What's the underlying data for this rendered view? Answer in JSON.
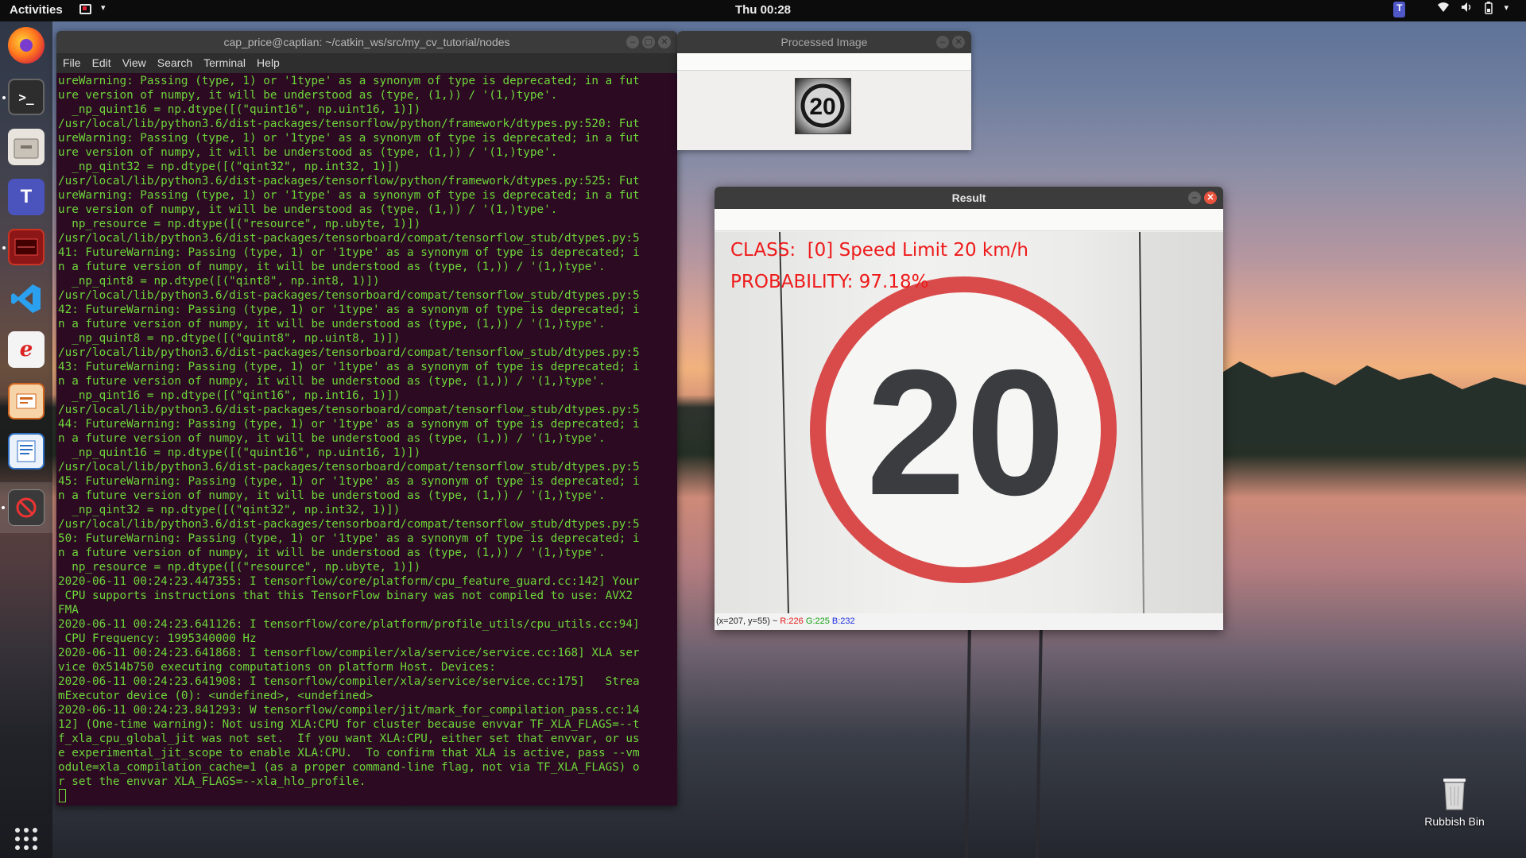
{
  "topbar": {
    "activities": "Activities",
    "clock": "Thu 00:28",
    "app_menu_arrow": "▾"
  },
  "dock": {
    "apps": [
      "Firefox",
      "Terminal",
      "Files",
      "Microsoft Teams",
      "Screen recorder",
      "Visual Studio Code",
      "Evince",
      "Impress",
      "Writer",
      "Processed Image"
    ]
  },
  "terminal": {
    "title": "cap_price@captian: ~/catkin_ws/src/my_cv_tutorial/nodes",
    "menu": [
      "File",
      "Edit",
      "View",
      "Search",
      "Terminal",
      "Help"
    ],
    "lines": [
      "ureWarning: Passing (type, 1) or '1type' as a synonym of type is deprecated; in a fut",
      "ure version of numpy, it will be understood as (type, (1,)) / '(1,)type'.",
      "  _np_quint16 = np.dtype([(\"quint16\", np.uint16, 1)])",
      "/usr/local/lib/python3.6/dist-packages/tensorflow/python/framework/dtypes.py:520: Fut",
      "ureWarning: Passing (type, 1) or '1type' as a synonym of type is deprecated; in a fut",
      "ure version of numpy, it will be understood as (type, (1,)) / '(1,)type'.",
      "  _np_qint32 = np.dtype([(\"qint32\", np.int32, 1)])",
      "/usr/local/lib/python3.6/dist-packages/tensorflow/python/framework/dtypes.py:525: Fut",
      "ureWarning: Passing (type, 1) or '1type' as a synonym of type is deprecated; in a fut",
      "ure version of numpy, it will be understood as (type, (1,)) / '(1,)type'.",
      "  np_resource = np.dtype([(\"resource\", np.ubyte, 1)])",
      "/usr/local/lib/python3.6/dist-packages/tensorboard/compat/tensorflow_stub/dtypes.py:5",
      "41: FutureWarning: Passing (type, 1) or '1type' as a synonym of type is deprecated; i",
      "n a future version of numpy, it will be understood as (type, (1,)) / '(1,)type'.",
      "  _np_qint8 = np.dtype([(\"qint8\", np.int8, 1)])",
      "/usr/local/lib/python3.6/dist-packages/tensorboard/compat/tensorflow_stub/dtypes.py:5",
      "42: FutureWarning: Passing (type, 1) or '1type' as a synonym of type is deprecated; i",
      "n a future version of numpy, it will be understood as (type, (1,)) / '(1,)type'.",
      "  _np_quint8 = np.dtype([(\"quint8\", np.uint8, 1)])",
      "/usr/local/lib/python3.6/dist-packages/tensorboard/compat/tensorflow_stub/dtypes.py:5",
      "43: FutureWarning: Passing (type, 1) or '1type' as a synonym of type is deprecated; i",
      "n a future version of numpy, it will be understood as (type, (1,)) / '(1,)type'.",
      "  _np_qint16 = np.dtype([(\"qint16\", np.int16, 1)])",
      "/usr/local/lib/python3.6/dist-packages/tensorboard/compat/tensorflow_stub/dtypes.py:5",
      "44: FutureWarning: Passing (type, 1) or '1type' as a synonym of type is deprecated; i",
      "n a future version of numpy, it will be understood as (type, (1,)) / '(1,)type'.",
      "  _np_quint16 = np.dtype([(\"quint16\", np.uint16, 1)])",
      "/usr/local/lib/python3.6/dist-packages/tensorboard/compat/tensorflow_stub/dtypes.py:5",
      "45: FutureWarning: Passing (type, 1) or '1type' as a synonym of type is deprecated; i",
      "n a future version of numpy, it will be understood as (type, (1,)) / '(1,)type'.",
      "  _np_qint32 = np.dtype([(\"qint32\", np.int32, 1)])",
      "/usr/local/lib/python3.6/dist-packages/tensorboard/compat/tensorflow_stub/dtypes.py:5",
      "50: FutureWarning: Passing (type, 1) or '1type' as a synonym of type is deprecated; i",
      "n a future version of numpy, it will be understood as (type, (1,)) / '(1,)type'.",
      "  np_resource = np.dtype([(\"resource\", np.ubyte, 1)])",
      "2020-06-11 00:24:23.447355: I tensorflow/core/platform/cpu_feature_guard.cc:142] Your",
      " CPU supports instructions that this TensorFlow binary was not compiled to use: AVX2",
      "FMA",
      "2020-06-11 00:24:23.641126: I tensorflow/core/platform/profile_utils/cpu_utils.cc:94]",
      " CPU Frequency: 1995340000 Hz",
      "2020-06-11 00:24:23.641868: I tensorflow/compiler/xla/service/service.cc:168] XLA ser",
      "vice 0x514b750 executing computations on platform Host. Devices:",
      "2020-06-11 00:24:23.641908: I tensorflow/compiler/xla/service/service.cc:175]   Strea",
      "mExecutor device (0): <undefined>, <undefined>",
      "2020-06-11 00:24:23.841293: W tensorflow/compiler/jit/mark_for_compilation_pass.cc:14",
      "12] (One-time warning): Not using XLA:CPU for cluster because envvar TF_XLA_FLAGS=--t",
      "f_xla_cpu_global_jit was not set.  If you want XLA:CPU, either set that envvar, or us",
      "e experimental_jit_scope to enable XLA:CPU.  To confirm that XLA is active, pass --vm",
      "odule=xla_compilation_cache=1 (as a proper command-line flag, not via TF_XLA_FLAGS) o",
      "r set the envvar XLA_FLAGS=--xla_hlo_profile."
    ]
  },
  "processed_window": {
    "title": "Processed Image",
    "thumb_text": "20"
  },
  "result_window": {
    "title": "Result",
    "class_text": "CLASS:  [0] Speed Limit 20 km/h",
    "prob_text": "PROBABILITY: 97.18%",
    "sign_text": "20",
    "status_coords": "(x=207, y=55) ~ ",
    "status_r": "R:226",
    "status_g": "G:225",
    "status_b": "B:232"
  },
  "desktop": {
    "bin_label": "Rubbish Bin"
  },
  "colors": {
    "terminal_bg": "#2b0a22",
    "terminal_text": "#6ed63a",
    "overlay_red": "#ee1a1a",
    "sign_ring": "#d94b4b"
  }
}
